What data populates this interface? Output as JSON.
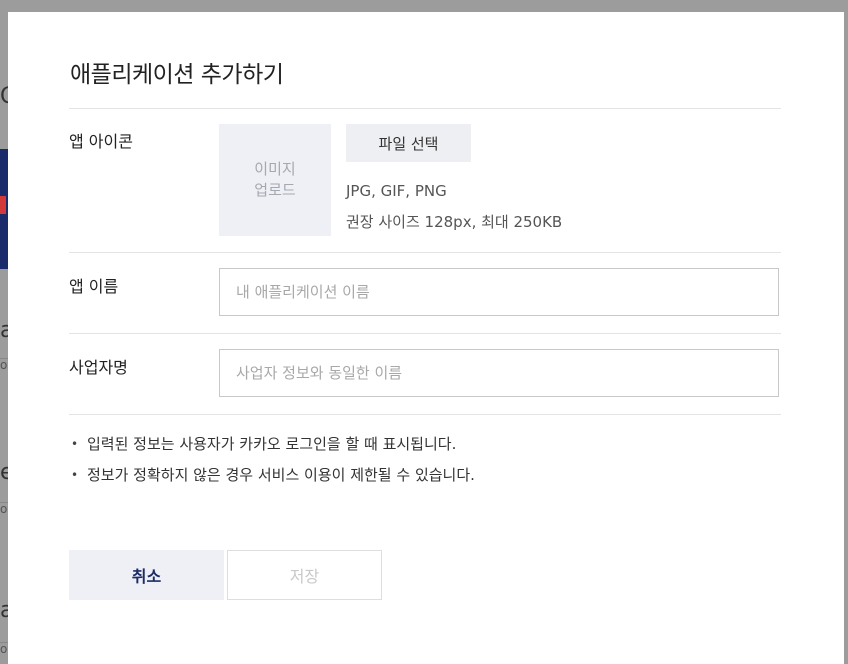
{
  "background": {
    "fragments": [
      "C",
      "a",
      "es",
      "a"
    ],
    "sub_fragments": [
      "o",
      "o",
      "o"
    ]
  },
  "dialog": {
    "title": "애플리케이션 추가하기",
    "icon_section": {
      "label": "앱 아이콘",
      "upload_line1": "이미지",
      "upload_line2": "업로드",
      "file_button": "파일 선택",
      "formats": "JPG, GIF, PNG",
      "size_hint": "권장 사이즈 128px, 최대 250KB"
    },
    "app_name": {
      "label": "앱 이름",
      "placeholder": "내 애플리케이션 이름"
    },
    "company_name": {
      "label": "사업자명",
      "placeholder": "사업자 정보와 동일한 이름"
    },
    "notes": [
      "입력된 정보는 사용자가 카카오 로그인을 할 때 표시됩니다.",
      "정보가 정확하지 않은 경우 서비스 이용이 제한될 수 있습니다."
    ],
    "cancel_label": "취소",
    "save_label": "저장"
  },
  "colors": {
    "accent_navy": "#1d2b66",
    "upload_bg": "#eef0f6"
  }
}
